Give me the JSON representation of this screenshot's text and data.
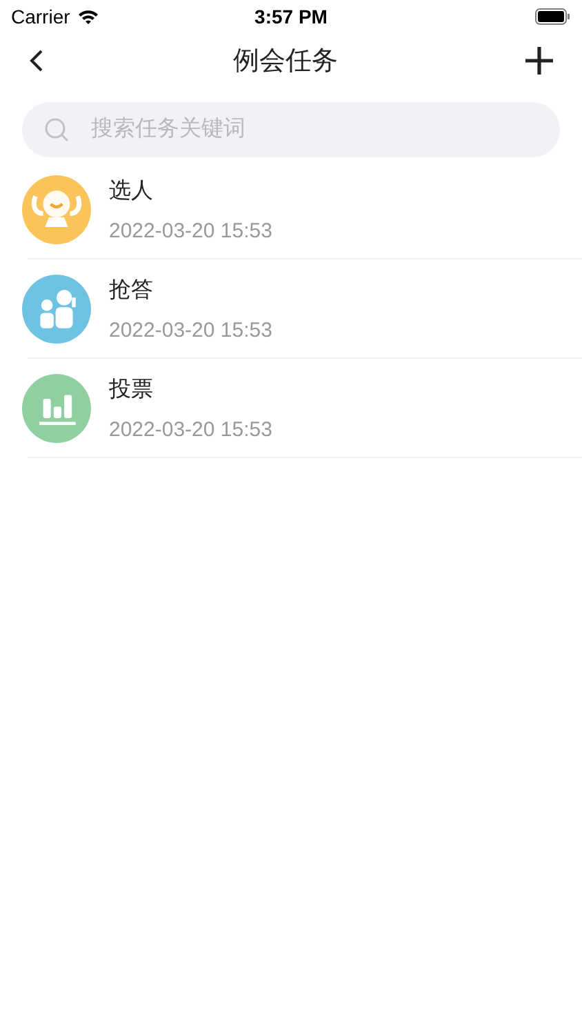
{
  "status_bar": {
    "carrier": "Carrier",
    "time": "3:57 PM"
  },
  "nav": {
    "title": "例会任务"
  },
  "search": {
    "placeholder": "搜索任务关键词"
  },
  "tasks": [
    {
      "kind": "pick",
      "color": "#fbc45a",
      "title": "选人",
      "date": "2022-03-20 15:53"
    },
    {
      "kind": "quiz",
      "color": "#6ec3e3",
      "title": "抢答",
      "date": "2022-03-20 15:53"
    },
    {
      "kind": "vote",
      "color": "#8fcfa0",
      "title": "投票",
      "date": "2022-03-20 15:53"
    }
  ]
}
